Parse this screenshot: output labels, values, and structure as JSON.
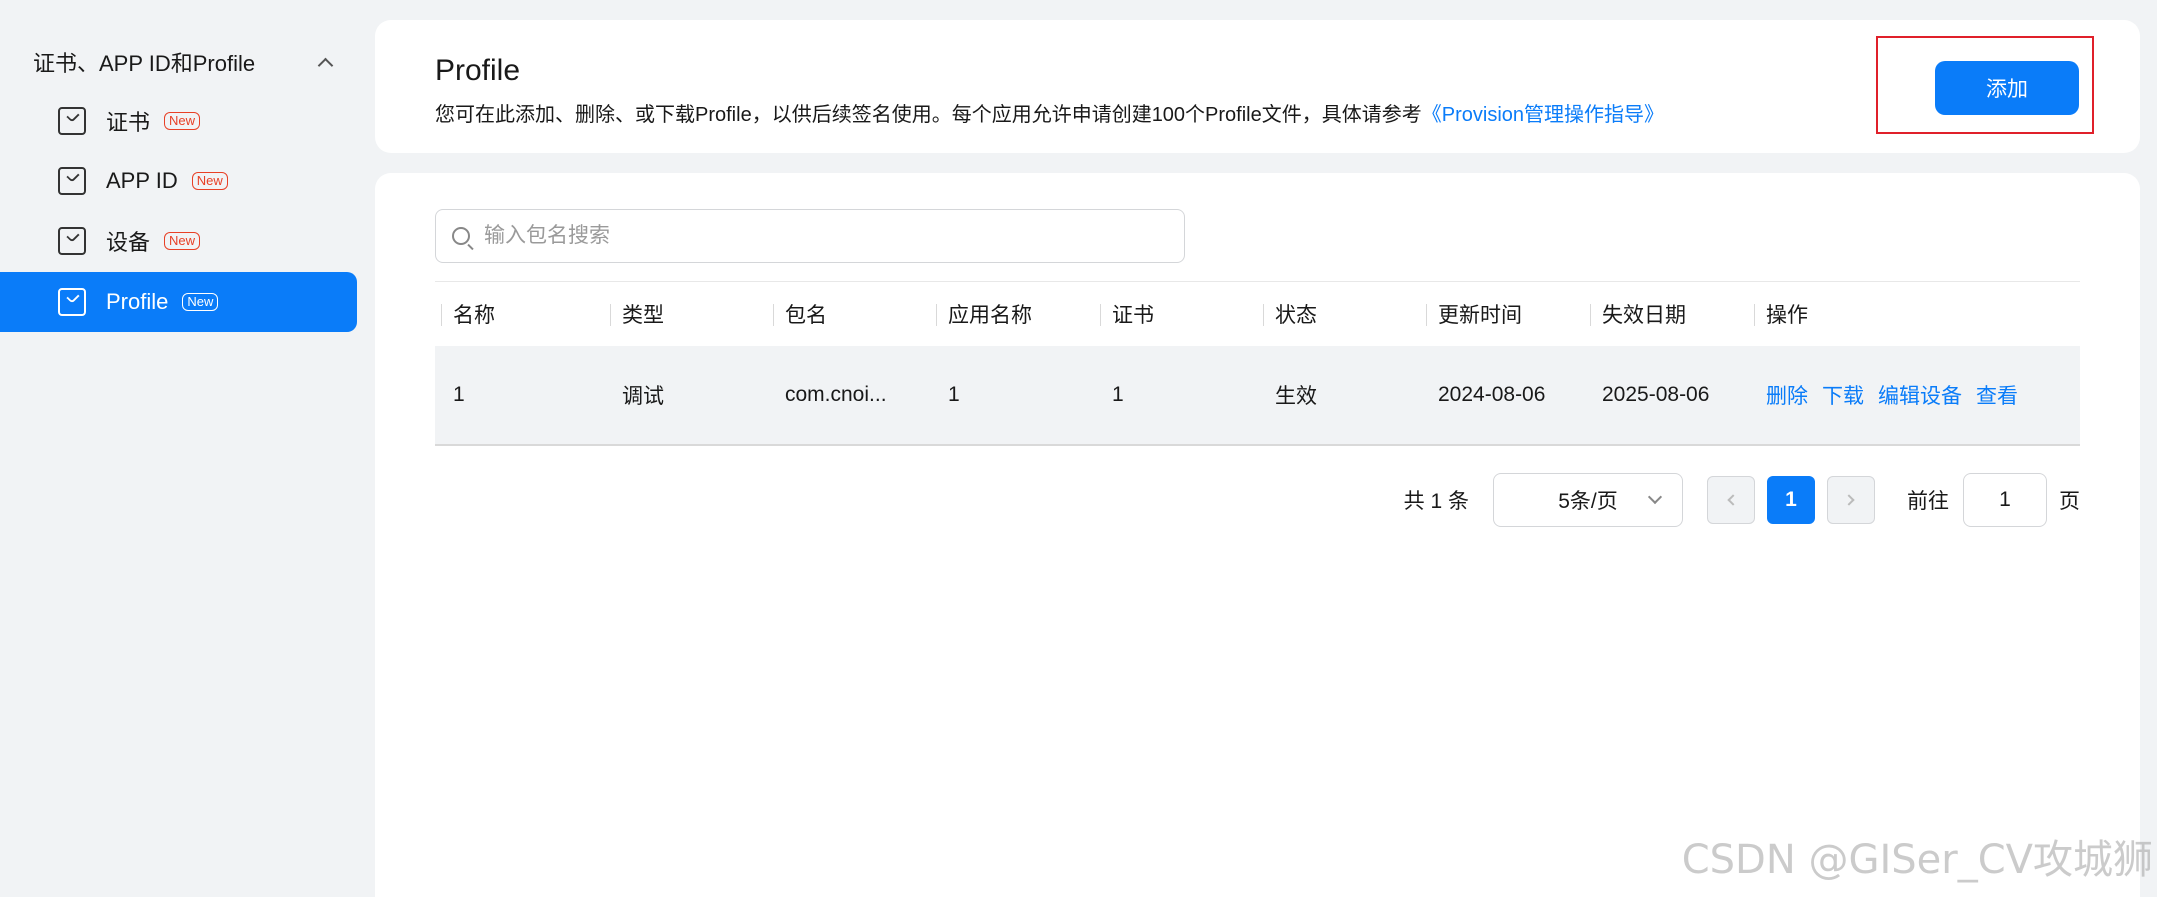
{
  "sidebar": {
    "group_label": "证书、APP ID和Profile",
    "items": [
      {
        "label": "证书",
        "badge": "New"
      },
      {
        "label": "APP ID",
        "badge": "New"
      },
      {
        "label": "设备",
        "badge": "New"
      },
      {
        "label": "Profile",
        "badge": "New"
      }
    ],
    "active_index": 3
  },
  "header": {
    "title": "Profile",
    "description": "您可在此添加、删除、或下载Profile，以供后续签名使用。每个应用允许申请创建100个Profile文件，具体请参考",
    "link_text": "《Provision管理操作指导》",
    "add_button": "添加"
  },
  "search": {
    "placeholder": "输入包名搜索",
    "value": ""
  },
  "table": {
    "columns": [
      "名称",
      "类型",
      "包名",
      "应用名称",
      "证书",
      "状态",
      "更新时间",
      "失效日期",
      "操作"
    ],
    "rows": [
      {
        "name": "1",
        "type": "调试",
        "package": "com.cnoi...",
        "app_name": "1",
        "cert": "1",
        "status": "生效",
        "updated": "2024-08-06",
        "expires": "2025-08-06",
        "actions": [
          "删除",
          "下载",
          "编辑设备",
          "查看"
        ]
      }
    ]
  },
  "pagination": {
    "total": "共 1 条",
    "page_size": "5条/页",
    "current_page": "1",
    "goto_label": "前往",
    "goto_value": "1",
    "page_unit": "页"
  },
  "watermark": "CSDN @GISer_CV攻城狮",
  "colors": {
    "accent": "#0a7cf9",
    "badge": "#e84026",
    "highlight": "#e0202a",
    "background": "#f1f3f5"
  }
}
